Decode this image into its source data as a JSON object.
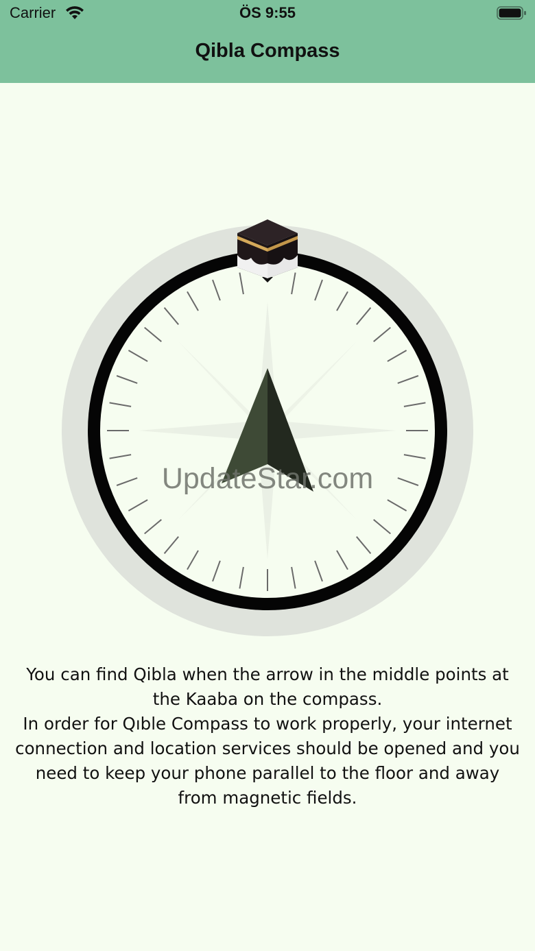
{
  "status_bar": {
    "carrier": "Carrier",
    "time": "ÖS 9:55",
    "wifi_icon": "wifi-icon",
    "battery_icon": "battery-icon"
  },
  "header": {
    "title": "Qibla Compass"
  },
  "compass": {
    "kaaba_icon": "kaaba-icon",
    "needle_icon": "compass-needle-icon",
    "watermark": "UpdateStar.com"
  },
  "instructions": {
    "line1": "You can find Qibla when the arrow in the middle points at the Kaaba on the compass.",
    "line2": "In order for Qıble Compass to work properly, your internet connection and location services should be opened and you need to keep your phone parallel to the floor and away from magnetic fields."
  },
  "colors": {
    "header_bg": "#7dc19c",
    "page_bg": "#f6fdf0",
    "ring_outer": "#dfe3dc",
    "ring_black": "#050505",
    "needle_left": "#3e4a36",
    "needle_right": "#23291f",
    "kaaba_gold": "#d4a95a"
  }
}
